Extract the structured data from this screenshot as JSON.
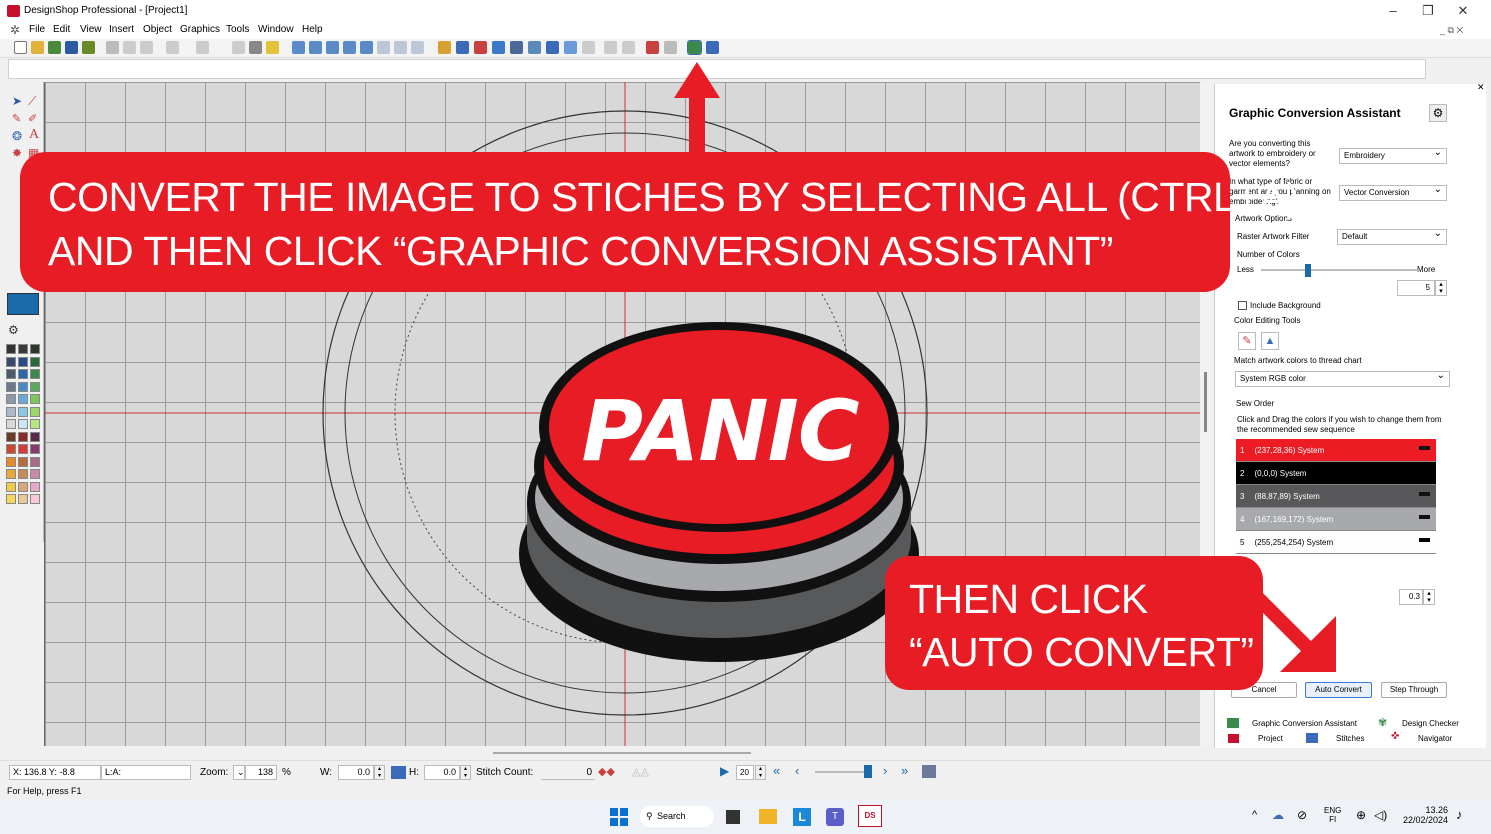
{
  "window": {
    "title": "DesignShop Professional - [Project1]",
    "controls": {
      "minimize": "–",
      "maximize": "❐",
      "close": "✕"
    }
  },
  "menu": {
    "items": [
      "File",
      "Edit",
      "View",
      "Insert",
      "Object",
      "Graphics",
      "Tools",
      "Window",
      "Help"
    ],
    "mdi_controls": "_ ⧉ ✕"
  },
  "artwork": {
    "button_text": "PANIC",
    "colors": {
      "red": "#e81c24",
      "black": "#111111",
      "gray_dark": "#58595b",
      "gray_light": "#a7a9ac"
    }
  },
  "panel": {
    "title": "Graphic Conversion Assistant",
    "q1": "Are you converting this artwork to embroidery or vector elements?",
    "q1_value": "Embroidery",
    "q2": "In what type of fabric or garment are you planning on embroidering?",
    "q2_value": "Vector Conversion",
    "artwork_options": "Artwork Options",
    "raster_filter_label": "Raster Artwork Filter",
    "raster_filter_value": "Default",
    "num_colors_label": "Number of Colors",
    "less": "Less",
    "more": "More",
    "num_colors_value": "5",
    "include_background": "Include Background",
    "color_editing_tools": "Color Editing Tools",
    "match_label": "Match artwork colors to thread chart",
    "match_value": "System RGB color",
    "sew_order_label": "Sew Order",
    "sew_order_hint": "Click and Drag the colors if you wish to change them from the recommended sew sequence",
    "sew_order": [
      {
        "index": "1",
        "label": "(237,28,36) System",
        "color": "#ed1c24",
        "text_color": "#ffffff"
      },
      {
        "index": "2",
        "label": "(0,0,0) System",
        "color": "#000000",
        "text_color": "#ffffff"
      },
      {
        "index": "3",
        "label": "(88,87,89) System",
        "color": "#585759",
        "text_color": "#ffffff"
      },
      {
        "index": "4",
        "label": "(167,169,172) System",
        "color": "#a7a9ac",
        "text_color": "#ffffff"
      },
      {
        "index": "5",
        "label": "(255,254,254) System",
        "color": "#fffefe",
        "text_color": "#000000"
      }
    ],
    "tolerance_value": "0.3",
    "buttons": {
      "cancel": "Cancel",
      "auto_convert": "Auto Convert",
      "step_through": "Step Through"
    },
    "bottom_tabs": [
      "Graphic Conversion Assistant",
      "Design Checker",
      "Project",
      "Stitches",
      "Navigator"
    ]
  },
  "callouts": {
    "main_line1": "CONVERT THE IMAGE TO STICHES BY SELECTING ALL (CTRL+A)",
    "main_line2": "AND THEN CLICK “GRAPHIC CONVERSION ASSISTANT”",
    "secondary_line1": "THEN CLICK",
    "secondary_line2": "“AUTO CONVERT”"
  },
  "status": {
    "coords": "X: 136.8  Y: -8.8",
    "la": "L:A:",
    "zoom_label": "Zoom:",
    "zoom_value": "138",
    "zoom_unit": "%",
    "w_label": "W:",
    "w_value": "0.0",
    "h_label": "H:",
    "h_value": "0.0",
    "stitch_count_label": "Stitch Count:",
    "stitch_count_value": "0",
    "speed_value": "20",
    "help": "For Help, press F1"
  },
  "taskbar": {
    "search": "Search",
    "lang_top": "ENG",
    "lang_bottom": "FI",
    "time": "13.26",
    "date": "22/02/2024"
  }
}
